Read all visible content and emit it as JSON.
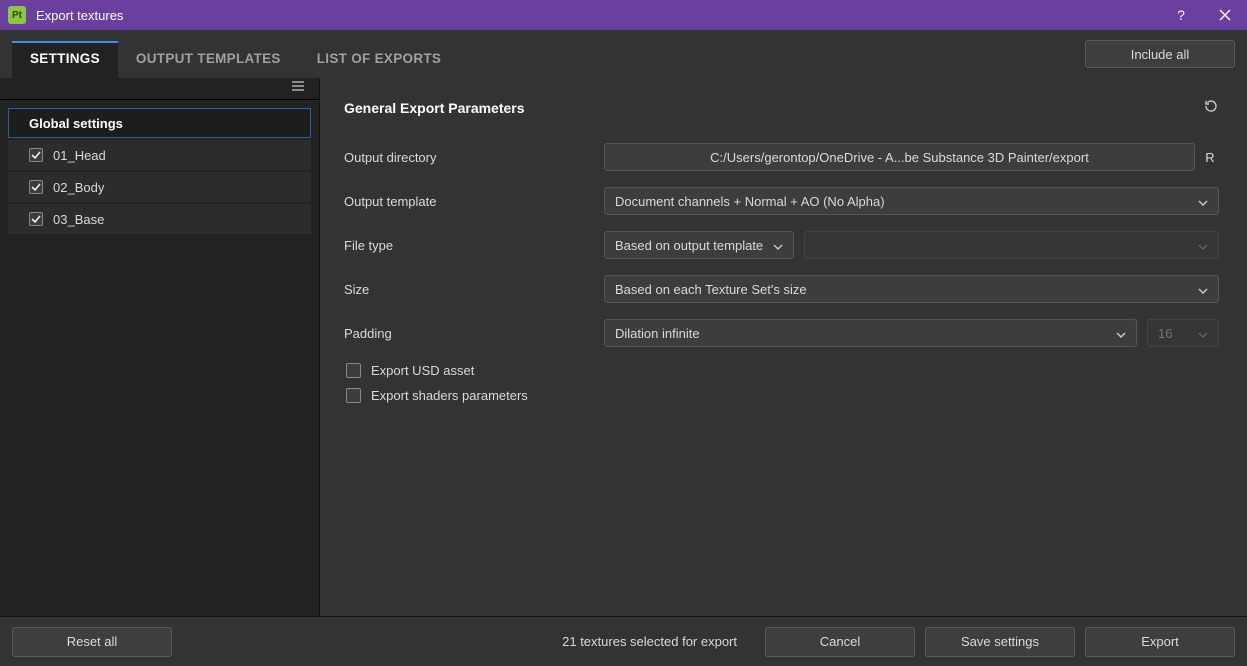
{
  "window": {
    "app_icon_text": "Pt",
    "title": "Export textures"
  },
  "toolbar": {
    "tabs": [
      {
        "label": "SETTINGS",
        "active": true
      },
      {
        "label": "OUTPUT TEMPLATES",
        "active": false
      },
      {
        "label": "LIST OF EXPORTS",
        "active": false
      }
    ],
    "include_all": "Include all"
  },
  "sidebar": {
    "global_label": "Global settings",
    "items": [
      {
        "label": "01_Head",
        "checked": true
      },
      {
        "label": "02_Body",
        "checked": true
      },
      {
        "label": "03_Base",
        "checked": true
      }
    ]
  },
  "main": {
    "header": "General Export Parameters",
    "output_directory": {
      "label": "Output directory",
      "value": "C:/Users/gerontop/OneDrive - A...be Substance 3D Painter/export",
      "browse_label": "R"
    },
    "output_template": {
      "label": "Output template",
      "value": "Document channels + Normal + AO (No Alpha)"
    },
    "file_type": {
      "label": "File type",
      "value": "Based on output template",
      "secondary_value": ""
    },
    "size": {
      "label": "Size",
      "value": "Based on each Texture Set's size"
    },
    "padding": {
      "label": "Padding",
      "value": "Dilation infinite",
      "amount": "16"
    },
    "export_usd": {
      "label": "Export USD asset",
      "checked": false
    },
    "export_shaders": {
      "label": "Export shaders parameters",
      "checked": false
    }
  },
  "footer": {
    "reset_all": "Reset all",
    "status": "21 textures selected for export",
    "cancel": "Cancel",
    "save_settings": "Save settings",
    "export": "Export"
  }
}
